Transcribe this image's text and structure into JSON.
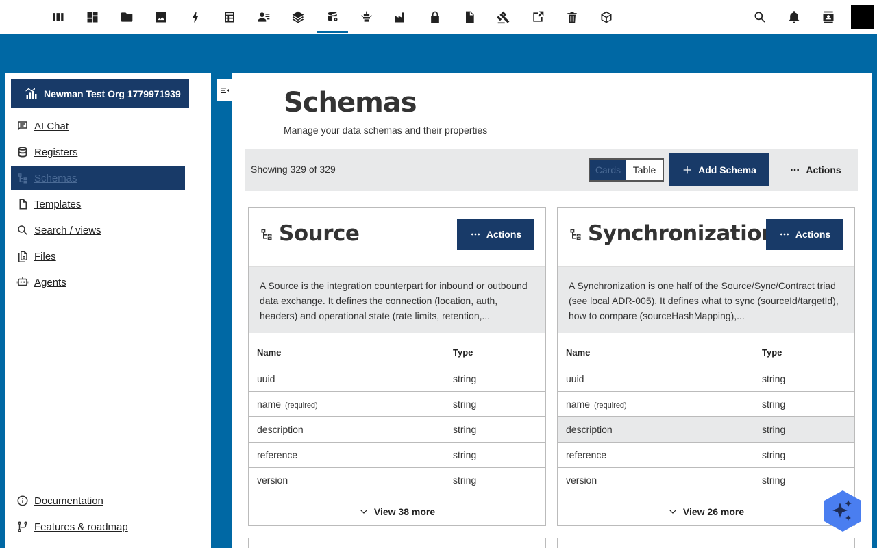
{
  "topbar": {
    "apps": [
      {
        "icon": "dashboard-columns-icon",
        "active": false
      },
      {
        "icon": "grid-icon",
        "active": false
      },
      {
        "icon": "folder-icon",
        "active": false
      },
      {
        "icon": "image-icon",
        "active": false
      },
      {
        "icon": "lightning-icon",
        "active": false
      },
      {
        "icon": "calendar-table-icon",
        "active": false
      },
      {
        "icon": "contacts-icon",
        "active": false
      },
      {
        "icon": "layers-icon",
        "active": false
      },
      {
        "icon": "database-cog-icon",
        "active": true
      },
      {
        "icon": "bug-icon",
        "active": false
      },
      {
        "icon": "factory-icon",
        "active": false
      },
      {
        "icon": "lock-icon",
        "active": false
      },
      {
        "icon": "document-icon",
        "active": false
      },
      {
        "icon": "gavel-icon",
        "active": false
      },
      {
        "icon": "export-box-icon",
        "active": false
      },
      {
        "icon": "trash-icon",
        "active": false
      },
      {
        "icon": "cube-icon",
        "active": false
      }
    ],
    "right_icons": [
      "search-icon",
      "bell-icon",
      "contact-card-icon"
    ]
  },
  "sidebar": {
    "org_name": "Newman Test Org 1779971939",
    "items": [
      {
        "label": "AI Chat",
        "icon": "chat-icon"
      },
      {
        "label": "Registers",
        "icon": "database-icon"
      },
      {
        "label": "Schemas",
        "icon": "schema-icon",
        "active": true
      },
      {
        "label": "Templates",
        "icon": "file-icon"
      },
      {
        "label": "Search / views",
        "icon": "search-icon"
      },
      {
        "label": "Files",
        "icon": "files-icon"
      },
      {
        "label": "Agents",
        "icon": "robot-icon"
      }
    ],
    "bottom_items": [
      {
        "label": "Documentation",
        "icon": "info-icon"
      },
      {
        "label": "Features & roadmap",
        "icon": "roadmap-icon"
      }
    ]
  },
  "main": {
    "title": "Schemas",
    "subtitle": "Manage your data schemas and their properties",
    "toolbar": {
      "count_text": "Showing 329 of 329",
      "view_cards": "Cards",
      "view_table": "Table",
      "add_label": "Add Schema",
      "actions_label": "Actions"
    },
    "table_headers": {
      "name": "Name",
      "type": "Type"
    },
    "cards": [
      {
        "name": "Source",
        "actions_label": "Actions",
        "description": "A Source is the integration counterpart for inbound or outbound data exchange. It defines the connection (location, auth, headers) and operational state (rate limits, retention,...",
        "properties": [
          {
            "name": "uuid",
            "required": "",
            "type": "string"
          },
          {
            "name": "name",
            "required": "(required)",
            "type": "string"
          },
          {
            "name": "description",
            "required": "",
            "type": "string"
          },
          {
            "name": "reference",
            "required": "",
            "type": "string"
          },
          {
            "name": "version",
            "required": "",
            "type": "string"
          }
        ],
        "more_label": "View 38 more"
      },
      {
        "name": "Synchronization",
        "actions_label": "Actions",
        "description": "A Synchronization is one half of the Source/Sync/Contract triad (see local ADR-005). It defines what to sync (sourceId/targetId), how to compare (sourceHashMapping),...",
        "properties": [
          {
            "name": "uuid",
            "required": "",
            "type": "string"
          },
          {
            "name": "name",
            "required": "(required)",
            "type": "string"
          },
          {
            "name": "description",
            "required": "",
            "type": "string"
          },
          {
            "name": "reference",
            "required": "",
            "type": "string"
          },
          {
            "name": "version",
            "required": "",
            "type": "string"
          }
        ],
        "more_label": "View 26 more"
      }
    ]
  },
  "colors": {
    "brand_blue": "#0068a4",
    "navy": "#183a68",
    "fab_blue": "#4a7ef0"
  }
}
